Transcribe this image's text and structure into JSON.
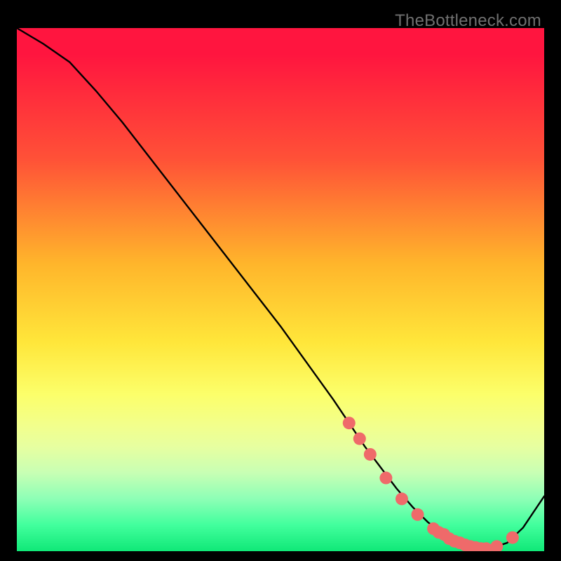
{
  "watermark": "TheBottleneck.com",
  "chart_data": {
    "type": "line",
    "title": "",
    "xlabel": "",
    "ylabel": "",
    "xlim": [
      0,
      100
    ],
    "ylim": [
      0,
      100
    ],
    "grid": false,
    "legend": false,
    "series": [
      {
        "name": "curve",
        "color": "#000000",
        "x": [
          0,
          5,
          10,
          15,
          20,
          25,
          30,
          35,
          40,
          45,
          50,
          55,
          60,
          63,
          66,
          69,
          72,
          75,
          78,
          81,
          84,
          86,
          88,
          90,
          93,
          96,
          100
        ],
        "y": [
          100,
          97,
          93.5,
          88,
          82,
          75.5,
          69,
          62.5,
          56,
          49.5,
          43,
          36,
          29,
          24.5,
          20,
          16,
          12,
          8.5,
          5.5,
          3.2,
          1.6,
          0.9,
          0.5,
          0.6,
          1.6,
          4.5,
          10.5
        ]
      }
    ],
    "markers": [
      {
        "name": "highlight-points",
        "color": "#ef6a6a",
        "radius": 9,
        "points": [
          {
            "x": 63,
            "y": 24.5
          },
          {
            "x": 65,
            "y": 21.5
          },
          {
            "x": 67,
            "y": 18.5
          },
          {
            "x": 70,
            "y": 14.0
          },
          {
            "x": 73,
            "y": 10.0
          },
          {
            "x": 76,
            "y": 7.0
          },
          {
            "x": 79,
            "y": 4.3
          },
          {
            "x": 80,
            "y": 3.6
          },
          {
            "x": 81,
            "y": 3.2
          },
          {
            "x": 82,
            "y": 2.4
          },
          {
            "x": 83,
            "y": 1.9
          },
          {
            "x": 84,
            "y": 1.6
          },
          {
            "x": 85,
            "y": 1.2
          },
          {
            "x": 86,
            "y": 0.9
          },
          {
            "x": 87,
            "y": 0.7
          },
          {
            "x": 88,
            "y": 0.5
          },
          {
            "x": 89,
            "y": 0.5
          },
          {
            "x": 91,
            "y": 0.9
          },
          {
            "x": 94,
            "y": 2.6
          }
        ]
      }
    ]
  }
}
